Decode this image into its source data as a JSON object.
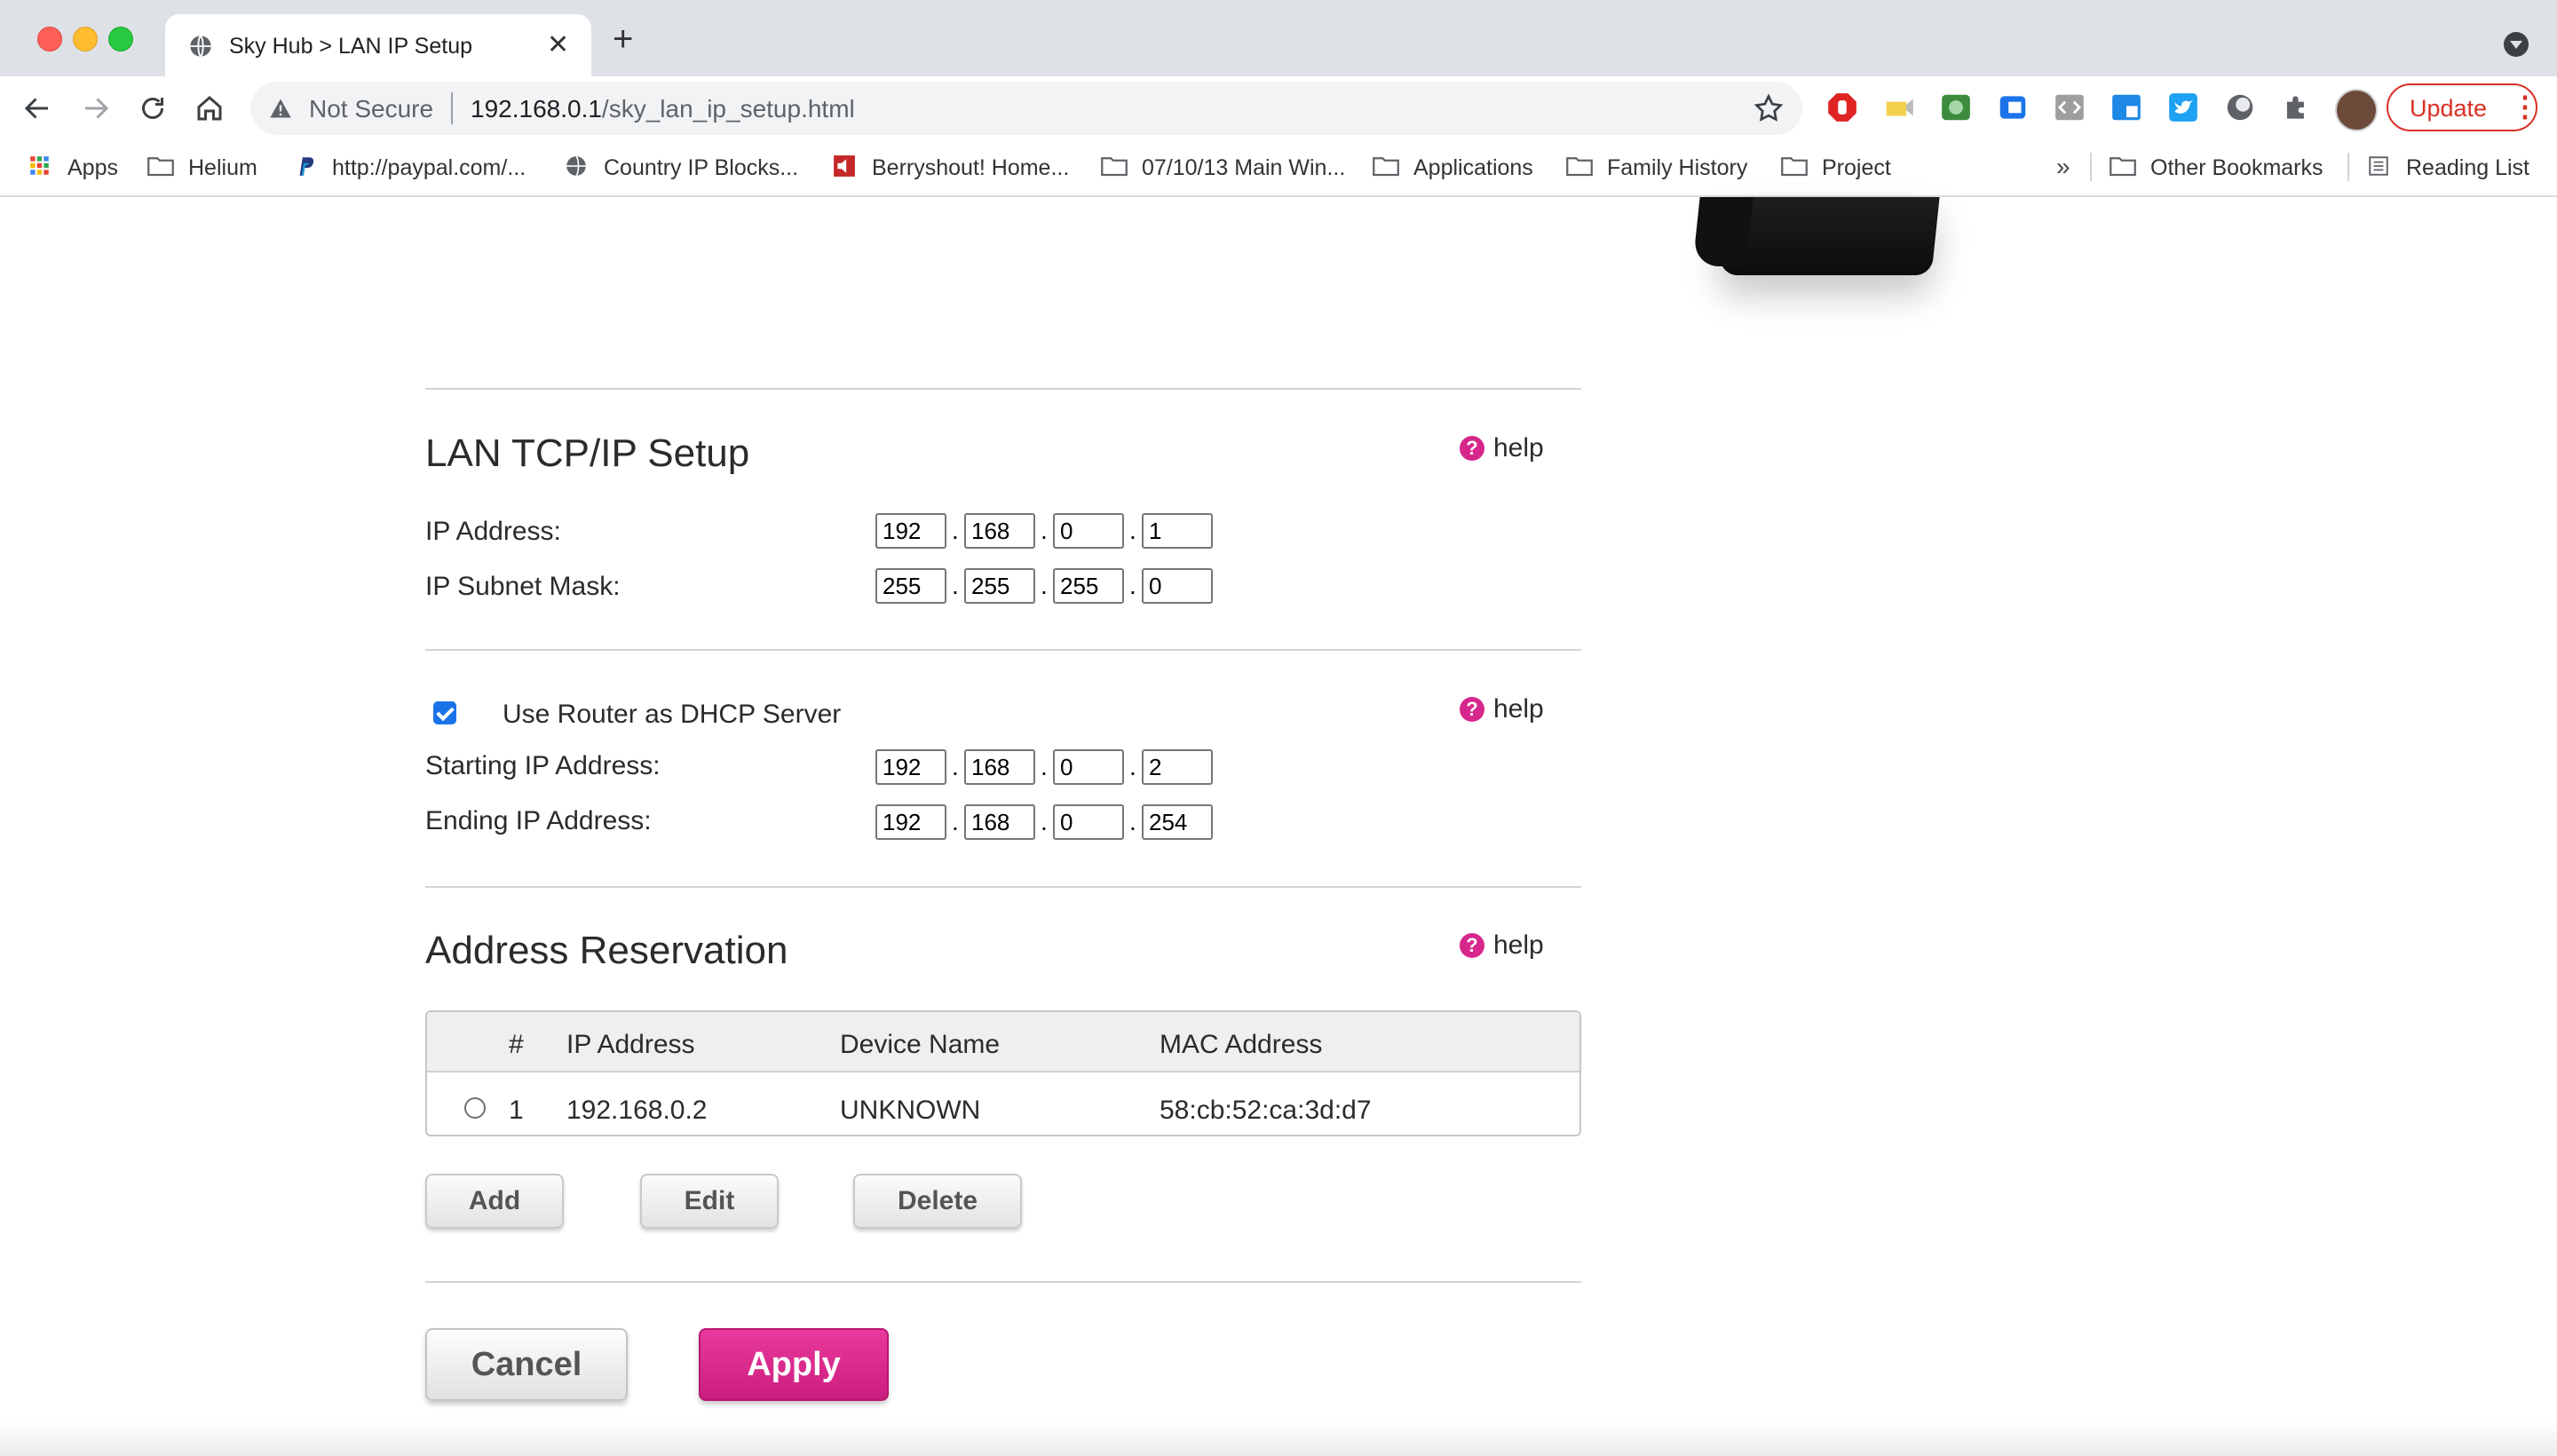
{
  "browser": {
    "tab_title": "Sky Hub > LAN IP Setup",
    "new_tab_label": "+",
    "security_label": "Not Secure",
    "url_host": "192.168.0.1",
    "url_path": "/sky_lan_ip_setup.html",
    "update_label": "Update",
    "bookmarks": [
      {
        "label": "Apps",
        "icon": "apps-grid-icon"
      },
      {
        "label": "Helium",
        "icon": "folder-icon"
      },
      {
        "label": "http://paypal.com/...",
        "icon": "paypal-icon"
      },
      {
        "label": "Country IP Blocks...",
        "icon": "globe-icon"
      },
      {
        "label": "Berryshout! Home...",
        "icon": "berryshout-icon"
      },
      {
        "label": "07/10/13 Main Win...",
        "icon": "folder-icon"
      },
      {
        "label": "Applications",
        "icon": "folder-icon"
      },
      {
        "label": "Family History",
        "icon": "folder-icon"
      },
      {
        "label": "Project",
        "icon": "folder-icon"
      }
    ],
    "overflow_label": "»",
    "other_bookmarks": "Other Bookmarks",
    "reading_list": "Reading List"
  },
  "lan_setup": {
    "title": "LAN TCP/IP Setup",
    "help_label": "help",
    "ip_address_label": "IP Address:",
    "ip_address": [
      "192",
      "168",
      "0",
      "1"
    ],
    "subnet_label": "IP Subnet Mask:",
    "subnet": [
      "255",
      "255",
      "255",
      "0"
    ]
  },
  "dhcp": {
    "checkbox_label": "Use Router as DHCP Server",
    "checked": true,
    "help_label": "help",
    "start_label": "Starting IP Address:",
    "start": [
      "192",
      "168",
      "0",
      "2"
    ],
    "end_label": "Ending IP Address:",
    "end": [
      "192",
      "168",
      "0",
      "254"
    ]
  },
  "reservation": {
    "title": "Address Reservation",
    "help_label": "help",
    "columns": [
      "#",
      "IP Address",
      "Device Name",
      "MAC Address"
    ],
    "rows": [
      {
        "num": "1",
        "ip": "192.168.0.2",
        "device": "UNKNOWN",
        "mac": "58:cb:52:ca:3d:d7"
      }
    ],
    "add_label": "Add",
    "edit_label": "Edit",
    "delete_label": "Delete"
  },
  "actions": {
    "cancel_label": "Cancel",
    "apply_label": "Apply"
  },
  "colors": {
    "accent": "#d6278c",
    "apply_button": "#d4278a"
  }
}
